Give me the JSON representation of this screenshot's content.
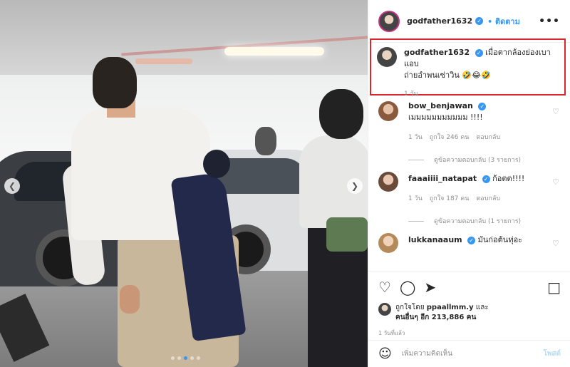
{
  "header": {
    "username": "godfather1632",
    "follow_label": "ติดตาม",
    "more_label": "•••"
  },
  "caption": {
    "username": "godfather1632",
    "text_line1": "เมื่อตากล้องย่องเบาแอบ",
    "text_line2": "ถ่ายอำพนเซ่าวิน 🤣😂🤣",
    "time": "1 วัน"
  },
  "comments": [
    {
      "username": "bow_benjawan",
      "text": "เมมมมมมมมมมม !!!!",
      "time": "1 วัน",
      "likes": "ถูกใจ 246 คน",
      "reply_label": "ตอบกลับ",
      "view_replies": "ดูข้อความตอบกลับ (3 รายการ)"
    },
    {
      "username": "faaaiiii_natapat",
      "text": "ก้อตต!!!!",
      "time": "1 วัน",
      "likes": "ถูกใจ 187 คน",
      "reply_label": "ตอบกลับ",
      "view_replies": "ดูข้อความตอบกลับ (1 รายการ)"
    },
    {
      "username": "lukkanaaum",
      "text": "มันก่อต้นทุ่อะ",
      "time": "",
      "likes": "",
      "reply_label": "",
      "view_replies": ""
    }
  ],
  "likes_line1_prefix": "ถูกใจโดย",
  "likes_line1_user": "ppaallmm.y",
  "likes_line1_suffix": "และ",
  "likes_line2": "คนอื่นๆ อีก 213,886 คน",
  "timestamp": "1 วันที่แล้ว",
  "add_comment": {
    "placeholder": "เพิ่มความคิดเห็น",
    "post_label": "โพสต์"
  },
  "icons": {
    "verified": "verified-icon",
    "heart": "heart-icon",
    "comment": "comment-icon",
    "share": "share-icon",
    "bookmark": "bookmark-icon",
    "emoji": "emoji-icon"
  },
  "colors": {
    "link_blue": "#3897f0",
    "highlight_red": "#d8262b",
    "muted": "#8e8e8e"
  }
}
